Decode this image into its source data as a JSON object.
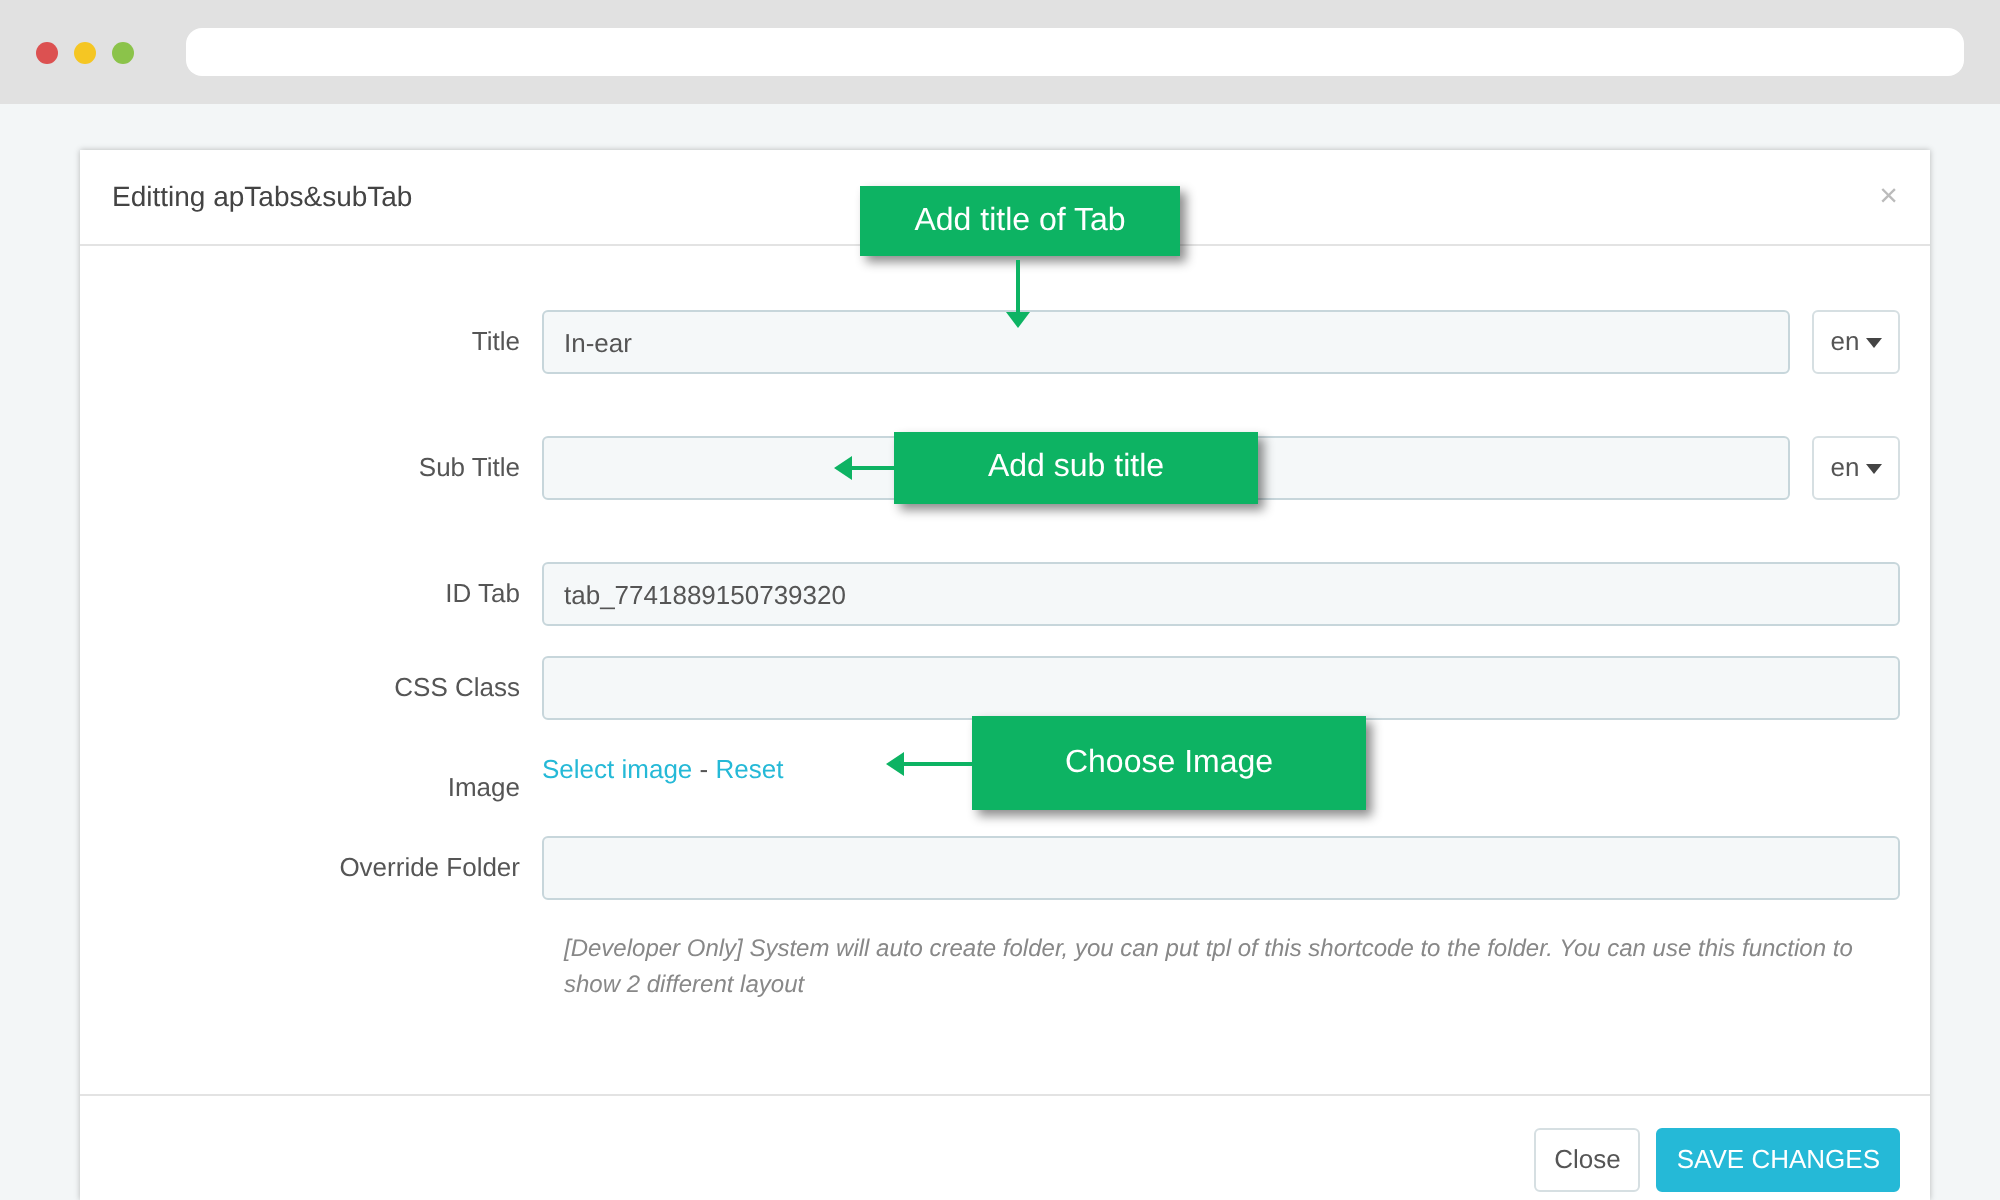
{
  "window": {
    "title": "Editting apTabs&subTab",
    "close_glyph": "×"
  },
  "fields": [
    {
      "kind": "lang_input",
      "label": "Title",
      "value": "In-ear",
      "language": "en"
    },
    {
      "kind": "lang_input",
      "label": "Sub Title",
      "language": "en"
    },
    {
      "kind": "input",
      "label": "ID Tab",
      "value": "tab_7741889150739320"
    },
    {
      "kind": "input",
      "label": "CSS Class"
    },
    {
      "kind": "links",
      "label": "Image",
      "links": [
        "Select image",
        "Reset"
      ],
      "separator": "-"
    },
    {
      "kind": "input",
      "label": "Override Folder",
      "help": "[Developer Only] System will auto create folder, you can put tpl of this shortcode to the folder. You can use this function to show 2 different layout"
    }
  ],
  "buttons": [
    {
      "label": "Close",
      "kind": "secondary"
    },
    {
      "label": "SAVE CHANGES",
      "kind": "primary"
    }
  ],
  "callouts": [
    {
      "text": "Add title of Tab",
      "kind": "down"
    },
    {
      "text": "Add sub title",
      "kind": "left"
    },
    {
      "text": "Choose Image",
      "kind": "left"
    }
  ]
}
